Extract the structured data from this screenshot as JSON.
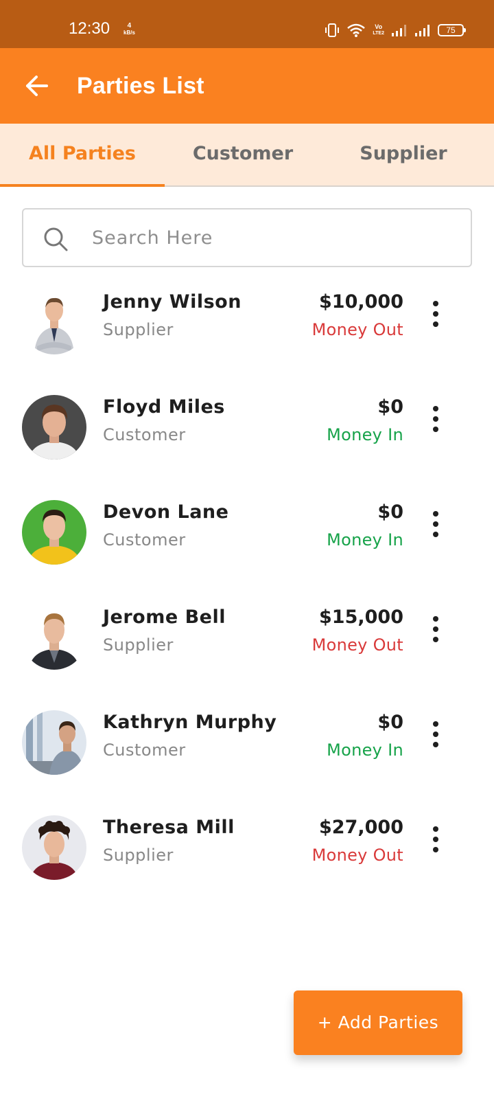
{
  "status_bar": {
    "time": "12:30",
    "net_speed_value": "4",
    "net_speed_unit": "kB/s",
    "volte_top": "Vo",
    "volte_bottom": "LTE2",
    "battery_level": "75"
  },
  "app_bar": {
    "title": "Parties List"
  },
  "tabs": [
    {
      "label": "All Parties",
      "active": true
    },
    {
      "label": "Customer",
      "active": false
    },
    {
      "label": "Supplier",
      "active": false
    }
  ],
  "search": {
    "placeholder": "Search Here",
    "value": ""
  },
  "parties": [
    {
      "name": "Jenny Wilson",
      "type": "Supplier",
      "amount": "$10,000",
      "flow": "Money Out",
      "flow_direction": "out"
    },
    {
      "name": "Floyd Miles",
      "type": "Customer",
      "amount": "$0",
      "flow": "Money In",
      "flow_direction": "in"
    },
    {
      "name": "Devon Lane",
      "type": "Customer",
      "amount": "$0",
      "flow": "Money In",
      "flow_direction": "in"
    },
    {
      "name": "Jerome Bell",
      "type": "Supplier",
      "amount": "$15,000",
      "flow": "Money Out",
      "flow_direction": "out"
    },
    {
      "name": "Kathryn Murphy",
      "type": "Customer",
      "amount": "$0",
      "flow": "Money In",
      "flow_direction": "in"
    },
    {
      "name": "Theresa Mill",
      "type": "Supplier",
      "amount": "$27,000",
      "flow": "Money Out",
      "flow_direction": "out"
    }
  ],
  "add_button": {
    "label": "+ Add Parties"
  },
  "colors": {
    "primary": "#fa8120",
    "status_bar": "#b85c14",
    "tab_background": "#feead9",
    "money_out": "#d93a3a",
    "money_in": "#17a34a"
  },
  "icons": {
    "back": "arrow-left-icon",
    "search": "search-icon",
    "more": "more-vertical-icon"
  }
}
